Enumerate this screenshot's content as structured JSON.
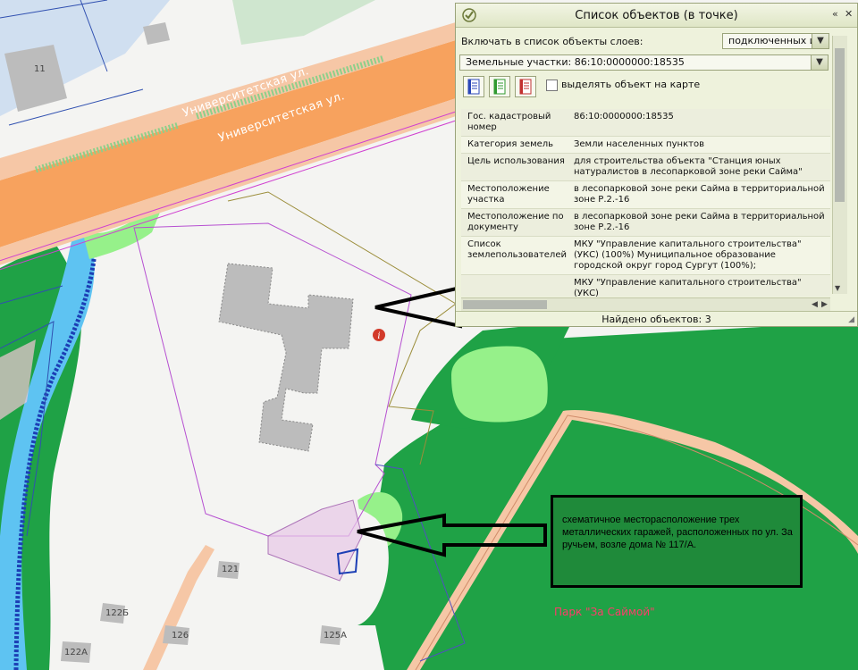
{
  "map": {
    "street_labels": [
      "Университетская ул.",
      "Университетская ул."
    ],
    "house_labels": [
      "11",
      "121",
      "122Б",
      "126",
      "125А",
      "122А"
    ],
    "park_label": "Парк \"За Саймой\"",
    "info_marker": "i",
    "note_text": "схематичное месторасположение трех металлических гаражей, расположенных по ул. За ручьем, возле  дома  № 117/А.",
    "colors": {
      "road": "#f7a25e",
      "forest": "#1fa246",
      "light_green": "#96f18a",
      "water": "#5ec3f2",
      "building": "#bcbcbc",
      "parcel_line": "#b64fd1",
      "arrow": "#000000"
    }
  },
  "panel": {
    "title": "Список объектов (в точке)",
    "titlebar_icons": [
      "check-icon",
      "collapse-icon",
      "close-icon"
    ],
    "collapse_glyph": "«",
    "close_glyph": "✕",
    "include_label": "Включать в список объекты слоев:",
    "include_value": "подключенных и",
    "layer_value": "Земельные участки: 86:10:0000000:18535",
    "dropdown_glyph": "▼",
    "doc_buttons": [
      "document-blue-icon",
      "document-green-icon",
      "document-red-icon"
    ],
    "highlight_label": "выделять объект на карте",
    "highlight_checked": false,
    "attributes": [
      {
        "key": "Гос. кадастровый номер",
        "value": "86:10:0000000:18535"
      },
      {
        "key": "Категория земель",
        "value": "Земли населенных пунктов"
      },
      {
        "key": "Цель использования",
        "value": "для строительства объекта \"Станция юных натуралистов в лесопарковой зоне реки Сайма\""
      },
      {
        "key": "Местоположение участка",
        "value": "в лесопарковой зоне реки Сайма в территориальной зоне Р.2.-16"
      },
      {
        "key": "Местоположение по документу",
        "value": "в лесопарковой зоне реки Сайма в территориальной зоне Р.2.-16"
      },
      {
        "key": "Список землепользователей",
        "value": "МКУ \"Управление капитального строительства\" (УКС) (100%) Муниципальное образование городской округ город Сургут (100%);"
      },
      {
        "key": "",
        "value": "МКУ \"Управление капитального строительства\" (УКС)"
      }
    ],
    "status": "Найдено объектов: 3"
  }
}
